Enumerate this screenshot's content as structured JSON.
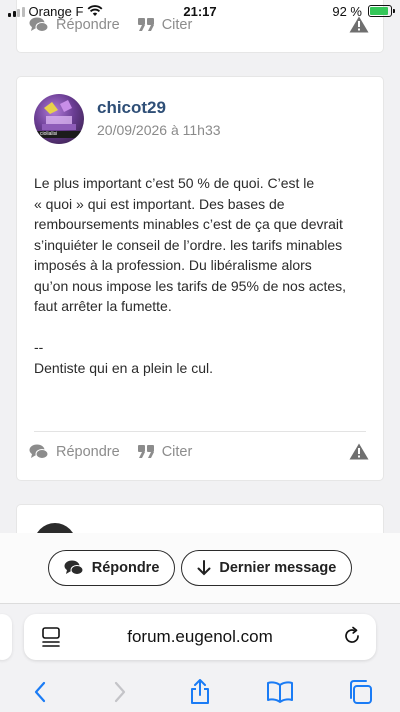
{
  "status_bar": {
    "carrier": "Orange F",
    "time": "21:17",
    "battery": "92 %",
    "battery_level_percent": 92
  },
  "previous_post": {
    "reply_label": "Répondre",
    "quote_label": "Citer"
  },
  "post": {
    "author": "chicot29",
    "date": "20/09/2026 à 11h33",
    "avatar_caption": "ciolialisi",
    "lines": [
      "Le plus important c’est 50 % de quoi. C’est le",
      "« quoi » qui est important. Des bases de",
      "remboursements minables c’est de ça que devrait",
      "s’inquiéter le conseil de l’ordre. les tarifs minables",
      "imposés à la profession. Du libéralisme alors",
      "qu’on nous impose les tarifs de 95% de nos actes,",
      "faut arrêter la fumette."
    ],
    "signature_sep": "--",
    "signature": "Dentiste qui en a plein le cul.",
    "reply_label": "Répondre",
    "quote_label": "Citer"
  },
  "bottom_bar": {
    "reply_label": "Répondre",
    "last_message_label": "Dernier message"
  },
  "browser": {
    "url": "forum.eugenol.com"
  },
  "colors": {
    "author": "#2f4f77",
    "action_grey": "#8c8c8c",
    "accent_blue": "#1b7cf5"
  }
}
